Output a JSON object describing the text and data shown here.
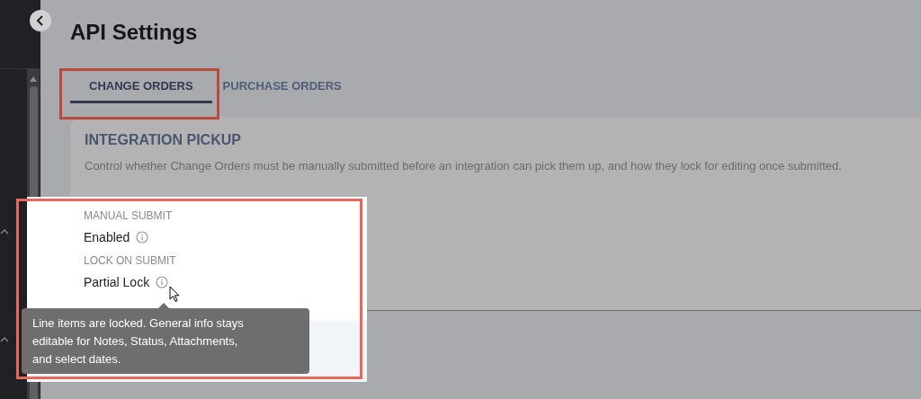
{
  "page": {
    "title": "API Settings"
  },
  "tabs": [
    {
      "label": "CHANGE ORDERS",
      "selected": true
    },
    {
      "label": "PURCHASE ORDERS",
      "selected": false
    }
  ],
  "section": {
    "title": "INTEGRATION PICKUP",
    "description": "Control whether Change Orders must be manually submitted before an integration can pick them up, and how they lock for editing once submitted."
  },
  "settings": [
    {
      "label": "MANUAL SUBMIT",
      "value": "Enabled"
    },
    {
      "label": "LOCK ON SUBMIT",
      "value": "Partial Lock"
    }
  ],
  "tooltip": {
    "text": "Line items are locked. General info stays editable for Notes, Status, Attachments, and select dates."
  }
}
